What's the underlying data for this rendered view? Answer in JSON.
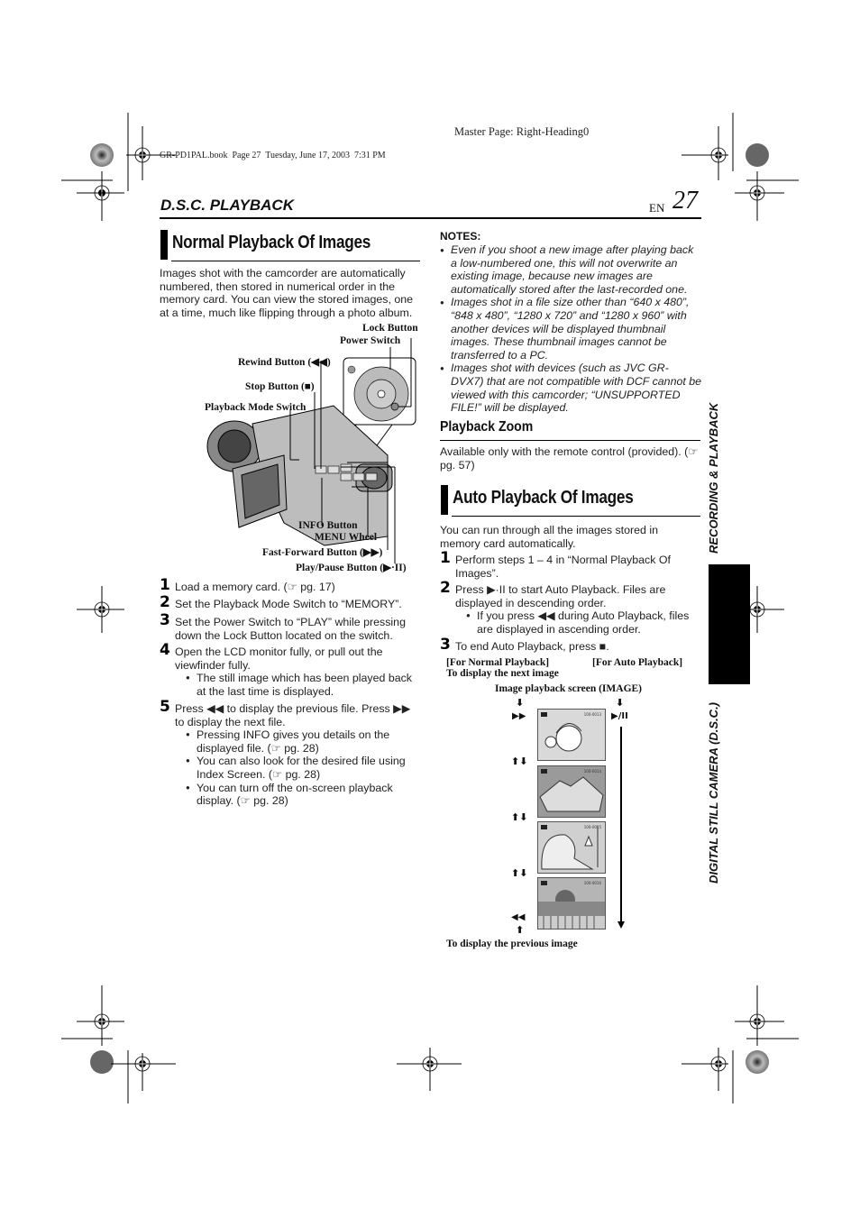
{
  "print_marks": {
    "master_page": "Master Page: Right-Heading0",
    "book_info": "GR-PD1PAL.book  Page 27  Tuesday, June 17, 2003  7:31 PM"
  },
  "header": {
    "section": "D.S.C. PLAYBACK",
    "lang": "EN",
    "page_number": "27"
  },
  "side_tabs": {
    "recording": "RECORDING & PLAYBACK",
    "dsc": "DIGITAL STILL CAMERA (D.S.C.)"
  },
  "normal": {
    "title": "Normal Playback Of Images",
    "intro": "Images shot with the camcorder are automatically numbered, then stored in numerical order in the memory card. You can view the stored images, one at a time, much like flipping through a photo album.",
    "diagram_labels": {
      "lock": "Lock Button",
      "power": "Power Switch",
      "rewind": "Rewind Button (◀◀)",
      "stop": "Stop Button (■)",
      "mode": "Playback Mode Switch",
      "info": "INFO Button",
      "menu": "MENU Wheel",
      "ff": "Fast-Forward Button (▶▶)",
      "play": "Play/Pause Button (▶·II)"
    },
    "steps": [
      {
        "n": "1",
        "text": "Load a memory card. (☞ pg. 17)"
      },
      {
        "n": "2",
        "text": "Set the Playback Mode Switch to “MEMORY”."
      },
      {
        "n": "3",
        "text": "Set the Power Switch to “PLAY” while pressing down the Lock Button located on the switch."
      },
      {
        "n": "4",
        "text": "Open the LCD monitor fully, or pull out the viewfinder fully.",
        "bullets": [
          "The still image which has been played back at the last time is displayed."
        ]
      },
      {
        "n": "5",
        "text": "Press ◀◀ to display the previous file. Press ▶▶ to display the next file.",
        "bullets": [
          "Pressing INFO gives you details on the displayed file. (☞ pg. 28)",
          "You can also look for the desired file using Index Screen. (☞ pg. 28)",
          "You can turn off the on-screen playback display. (☞ pg. 28)"
        ]
      }
    ]
  },
  "notes": {
    "title": "NOTES:",
    "items": [
      "Even if you shoot a new image after playing back a low-numbered one, this will not overwrite an existing image, because new images are automatically stored after the last-recorded one.",
      "Images shot in a file size other than “640 x 480”, “848 x 480”, “1280 x 720” and “1280 x 960” with another devices will be displayed thumbnail images. These thumbnail images cannot be transferred to a PC.",
      "Images shot with devices (such as JVC GR-DVX7) that are not compatible with DCF cannot be viewed with this camcorder; “UNSUPPORTED FILE!” will be displayed."
    ]
  },
  "zoom": {
    "title": "Playback Zoom",
    "text": "Available only with the remote control (provided). (☞ pg. 57)"
  },
  "auto": {
    "title": "Auto Playback Of Images",
    "intro": "You can run through all the images stored in memory card automatically.",
    "steps": [
      {
        "n": "1",
        "text": "Perform steps 1 – 4 in “Normal Playback Of Images”."
      },
      {
        "n": "2",
        "text": "Press ▶·II to start Auto Playback. Files are displayed in descending order.",
        "bullets": [
          "If you press ◀◀ during Auto Playback, files are displayed in ascending order."
        ]
      },
      {
        "n": "3",
        "text": "To end Auto Playback, press ■."
      }
    ],
    "figure": {
      "normal_label": "[For Normal Playback]",
      "auto_label": "[For Auto Playback]",
      "next_label": "To display the next image",
      "screen_label": "Image playback screen (IMAGE)",
      "prev_label": "To display the previous image",
      "ff_symbol": "▶▶",
      "play_symbol": "▶/II",
      "rew_symbol": "◀◀",
      "thumbs": [
        "100-0013",
        "100-0014",
        "100-0015",
        "100-0016"
      ]
    }
  }
}
